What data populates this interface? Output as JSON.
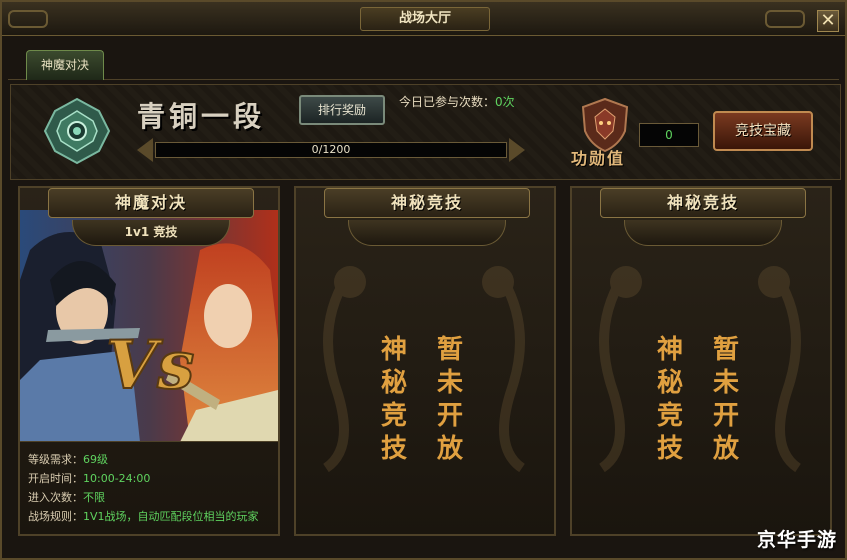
{
  "window": {
    "title": "战场大厅",
    "close_label": "✕"
  },
  "tabs": [
    {
      "label": "神魔对决",
      "active": true
    }
  ],
  "rank": {
    "title": "青铜一段",
    "reward_button": "排行奖励",
    "participation_label": "今日已参与次数：",
    "participation_value": "0次",
    "progress_text": "0/1200",
    "progress_fraction": 0.0
  },
  "honor": {
    "label": "功勋值",
    "value": "0",
    "treasure_button": "竞技宝藏"
  },
  "cards": [
    {
      "title": "神魔对决",
      "subtitle": "1v1 竞技",
      "vs_text": "Vs",
      "info": [
        {
          "label": "等级需求：",
          "value": "69级"
        },
        {
          "label": "开启时间：",
          "value": "10:00-24:00"
        },
        {
          "label": "进入次数：",
          "value": "不限"
        },
        {
          "label": "战场规则：",
          "value": "1V1战场，自动匹配段位相当的玩家"
        }
      ]
    },
    {
      "title": "神秘竞技",
      "locked_col1": [
        "神",
        "秘",
        "竞",
        "技"
      ],
      "locked_col2": [
        "暂",
        "未",
        "开",
        "放"
      ]
    },
    {
      "title": "神秘竞技",
      "locked_col1": [
        "神",
        "秘",
        "竞",
        "技"
      ],
      "locked_col2": [
        "暂",
        "未",
        "开",
        "放"
      ]
    }
  ],
  "watermark": "京华手游",
  "colors": {
    "accent_green": "#5fd35f",
    "gold": "#e0a040",
    "frame": "#4e4128"
  }
}
